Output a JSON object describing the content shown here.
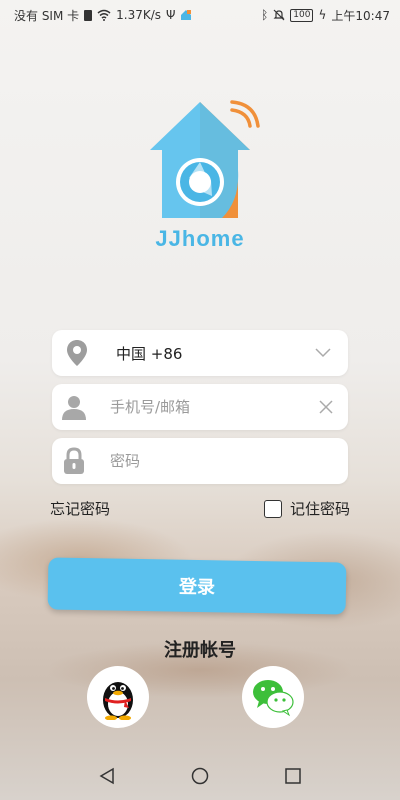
{
  "status_bar": {
    "carrier": "没有 SIM 卡",
    "speed": "1.37K/s",
    "battery": "100",
    "time": "上午10:47"
  },
  "app": {
    "brand": "JJhome"
  },
  "form": {
    "region": "中国 +86",
    "phone_placeholder": "手机号/邮箱",
    "password_placeholder": "密码",
    "forgot_password": "忘记密码",
    "remember_password": "记住密码",
    "login_label": "登录",
    "register_label": "注册帐号"
  },
  "social": [
    {
      "name": "qq",
      "icon": "qq-penguin-icon"
    },
    {
      "name": "wechat",
      "icon": "wechat-icon"
    }
  ],
  "colors": {
    "accent": "#5ac1ee",
    "brand_blue": "#4ab6e5",
    "brand_orange": "#f0903a",
    "wechat_green": "#3dbf3a"
  }
}
